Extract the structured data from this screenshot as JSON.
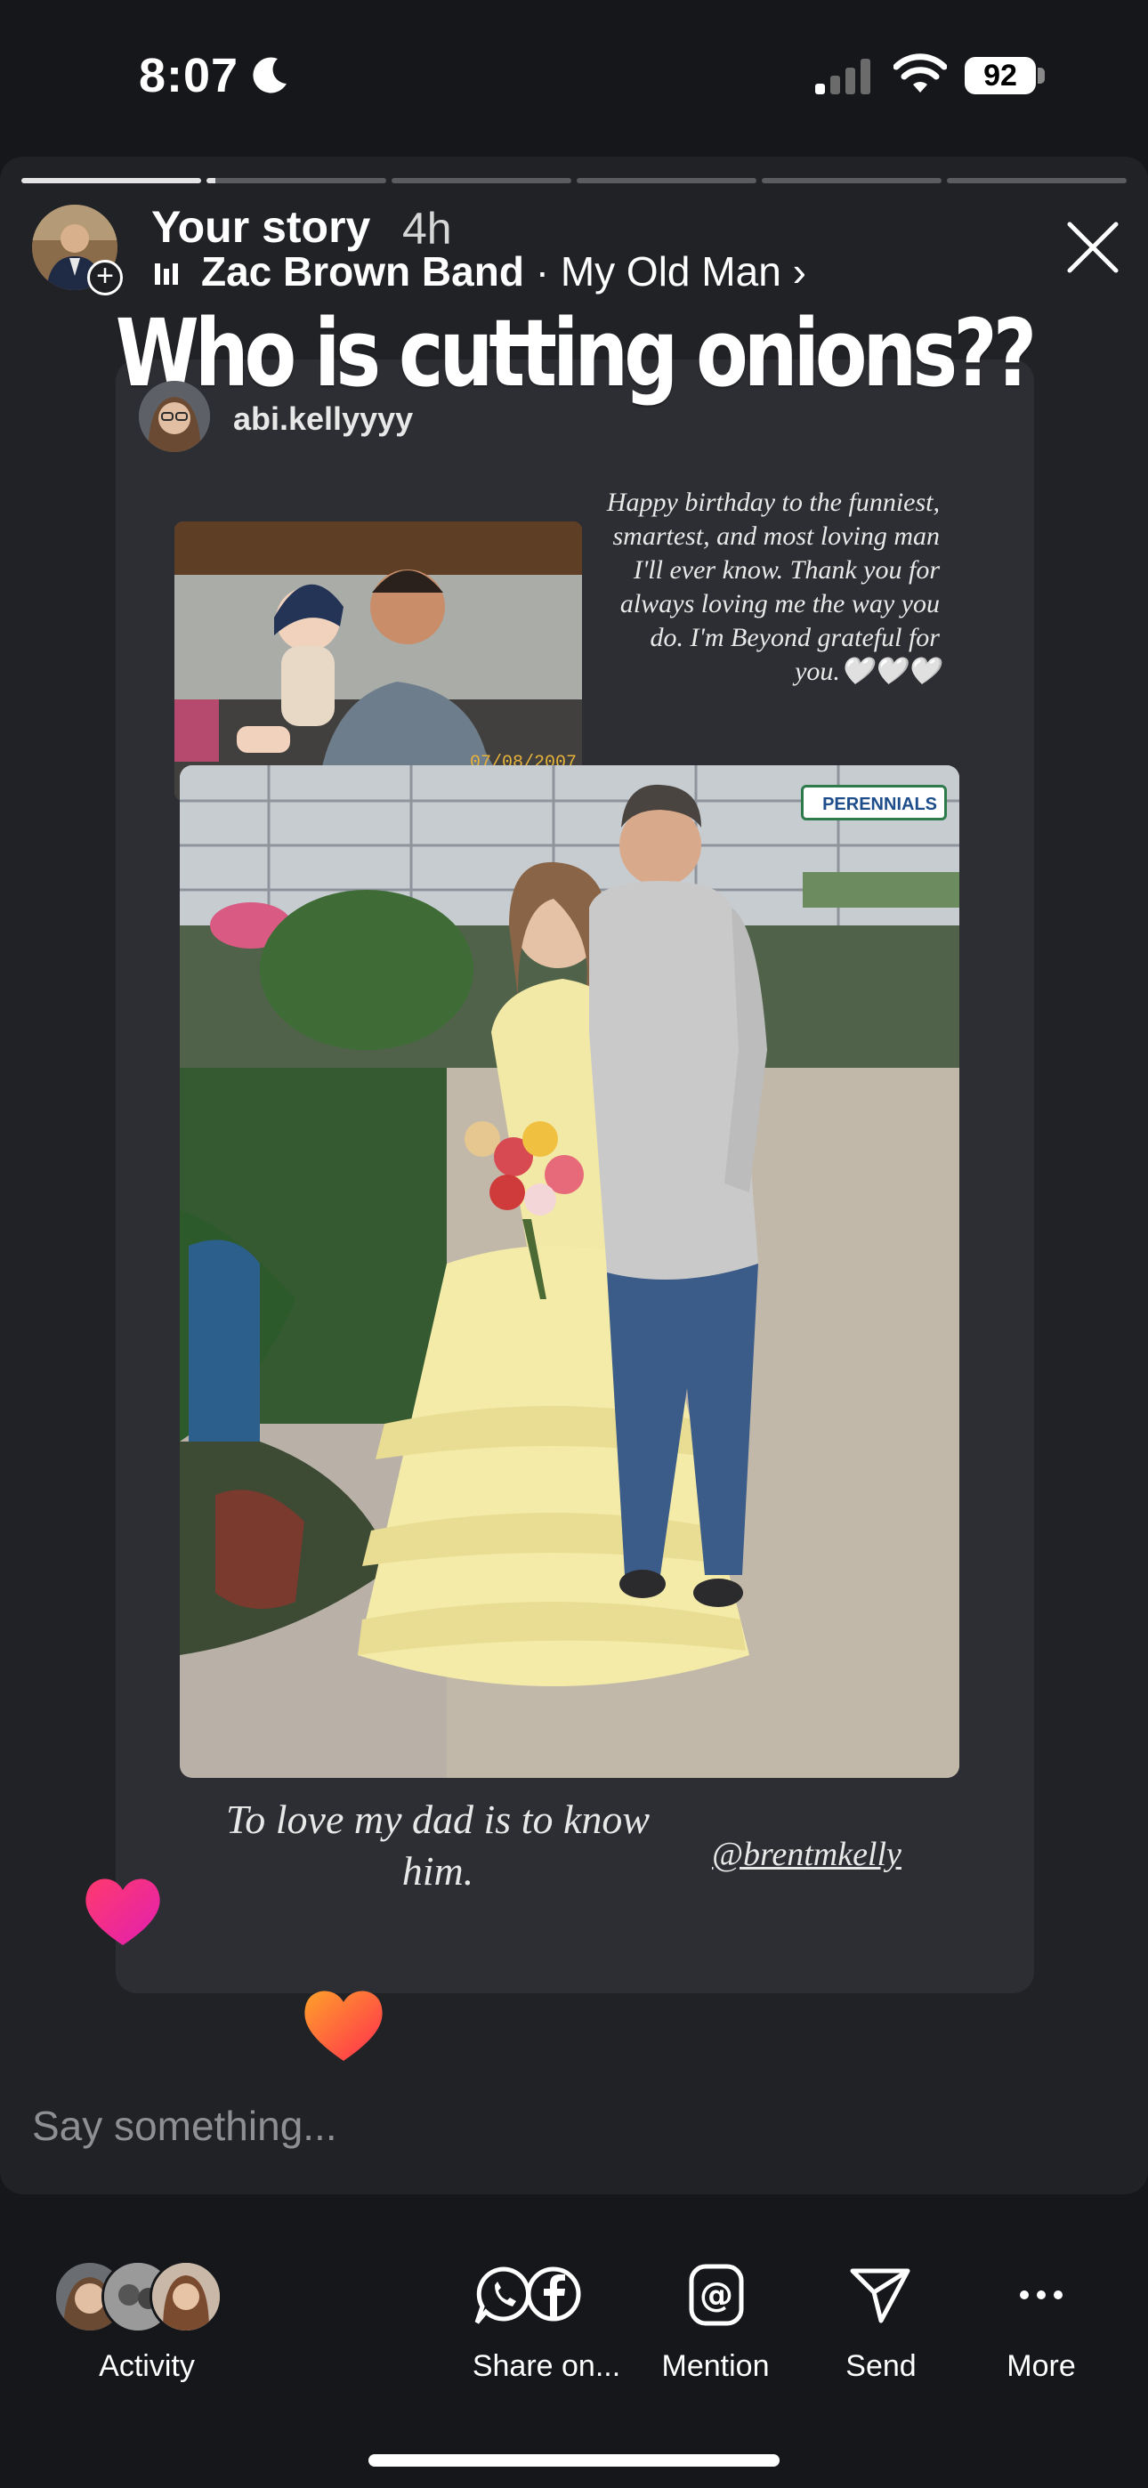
{
  "status_bar": {
    "time": "8:07",
    "battery": "92"
  },
  "story": {
    "owner_label": "Your story",
    "age": "4h",
    "music": {
      "artist": "Zac Brown Band",
      "separator": " · ",
      "song": "My Old Man",
      "chevron": "›"
    },
    "progress": {
      "segments": 6,
      "active_index": 1
    },
    "caption": "Who is cutting onions??",
    "reshared_post": {
      "username": "abi.kellyyyy",
      "birthday_message": "Happy birthday to the funniest, smartest, and most loving man I'll ever know. Thank you for always loving me the way you do. I'm Beyond grateful for you.🤍🤍🤍",
      "photo_date_stamp": "07/08/2007",
      "sign_text": "PERENNIALS",
      "bottom_caption": "To love my dad is to know him.",
      "mention": "@brentmkelly"
    }
  },
  "reply": {
    "placeholder": "Say something..."
  },
  "actions": {
    "activity": "Activity",
    "share": "Share on...",
    "mention": "Mention",
    "send": "Send",
    "more": "More"
  },
  "colors": {
    "background": "#15171a",
    "story_bg": "#202226",
    "card_bg": "#2c2e33",
    "heart_pink": "#ff2d8a",
    "heart_orange": "#ff6a1f"
  }
}
